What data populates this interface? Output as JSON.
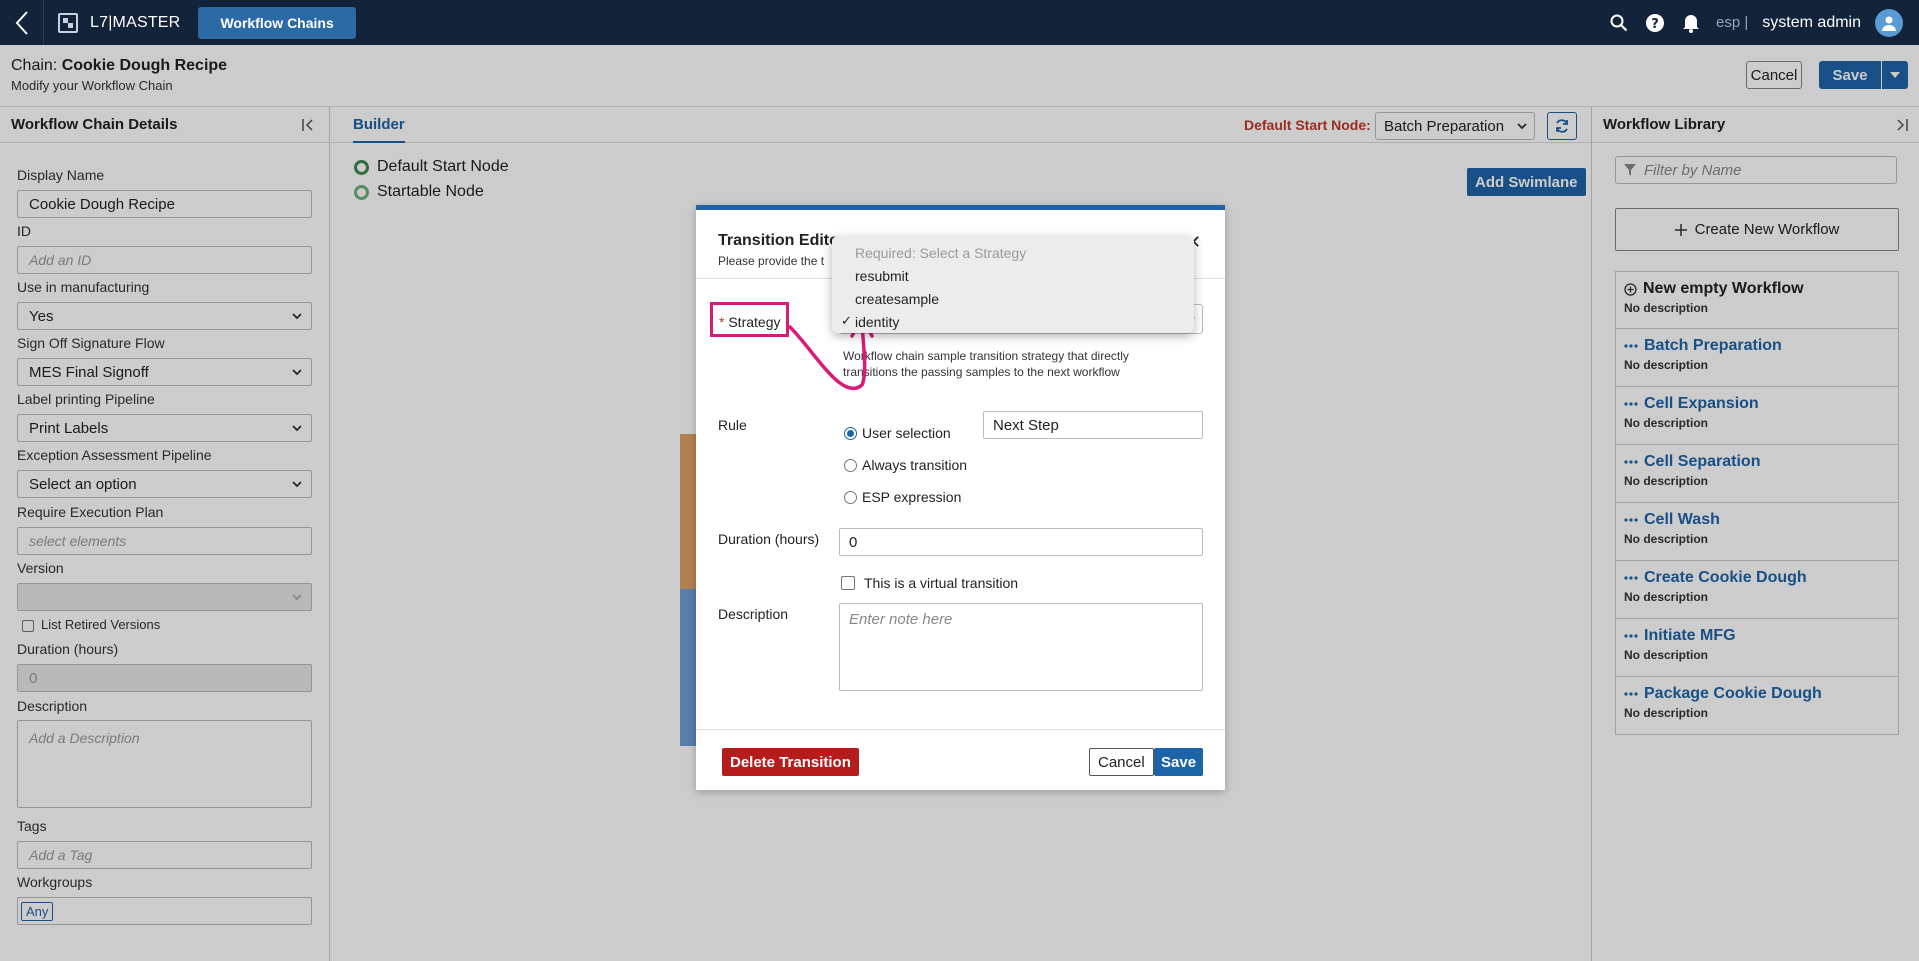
{
  "topbar": {
    "brand": "L7|MASTER",
    "app_tab": "Workflow Chains",
    "env": "esp |",
    "user": "system admin"
  },
  "header": {
    "chain_prefix": "Chain:",
    "chain_name": "Cookie Dough Recipe",
    "subtitle": "Modify your Workflow Chain",
    "cancel": "Cancel",
    "save": "Save"
  },
  "left": {
    "title": "Workflow Chain Details",
    "display_name_label": "Display Name",
    "display_name": "Cookie Dough Recipe",
    "id_label": "ID",
    "id_placeholder": "Add an ID",
    "manufacturing_label": "Use in manufacturing",
    "manufacturing": "Yes",
    "signoff_label": "Sign Off Signature Flow",
    "signoff": "MES Final Signoff",
    "label_pipeline_label": "Label printing Pipeline",
    "label_pipeline": "Print Labels",
    "exception_label": "Exception Assessment Pipeline",
    "exception": "Select an option",
    "exec_plan_label": "Require Execution Plan",
    "exec_plan_placeholder": "select elements",
    "version_label": "Version",
    "retired_label": "List Retired Versions",
    "duration_label": "Duration (hours)",
    "duration": "0",
    "description_label": "Description",
    "description_placeholder": "Add a Description",
    "tags_label": "Tags",
    "tags_placeholder": "Add a Tag",
    "workgroups_label": "Workgroups",
    "workgroup_chip": "Any"
  },
  "builder": {
    "tab": "Builder",
    "default_start_label": "Default Start Node:",
    "default_start_value": "Batch Preparation",
    "legend_default": "Default Start Node",
    "legend_startable": "Startable Node",
    "add_swimlane": "Add Swimlane"
  },
  "library": {
    "title": "Workflow Library",
    "filter_placeholder": "Filter by Name",
    "create": "Create New Workflow",
    "items": [
      {
        "name": "New empty Workflow",
        "desc": "No description"
      },
      {
        "name": "Batch Preparation",
        "desc": "No description"
      },
      {
        "name": "Cell Expansion",
        "desc": "No description"
      },
      {
        "name": "Cell Separation",
        "desc": "No description"
      },
      {
        "name": "Cell Wash",
        "desc": "No description"
      },
      {
        "name": "Create Cookie Dough",
        "desc": "No description"
      },
      {
        "name": "Initiate MFG",
        "desc": "No description"
      },
      {
        "name": "Package Cookie Dough",
        "desc": "No description"
      }
    ]
  },
  "modal": {
    "title": "Transition Edito",
    "subtitle": "Please provide the t",
    "strategy_req": "*",
    "strategy_label": "Strategy",
    "strategy_help": "Workflow chain sample transition strategy that directly transitions the passing samples to the next workflow",
    "strategy_options": [
      "Required: Select a Strategy",
      "resubmit",
      "createsample",
      "identity"
    ],
    "strategy_selected": "identity",
    "rule_label": "Rule",
    "rule_user": "User selection",
    "rule_always": "Always transition",
    "rule_esp": "ESP expression",
    "next_step": "Next Step",
    "duration_label": "Duration (hours)",
    "duration": "0",
    "virtual_label": "This is a virtual transition",
    "description_label": "Description",
    "description_placeholder": "Enter note here",
    "delete": "Delete Transition",
    "cancel": "Cancel",
    "save": "Save"
  },
  "colors": {
    "topbar": "#12233a",
    "primary": "#1d63a8",
    "danger": "#b71c1c",
    "highlight": "#d81b7a"
  }
}
